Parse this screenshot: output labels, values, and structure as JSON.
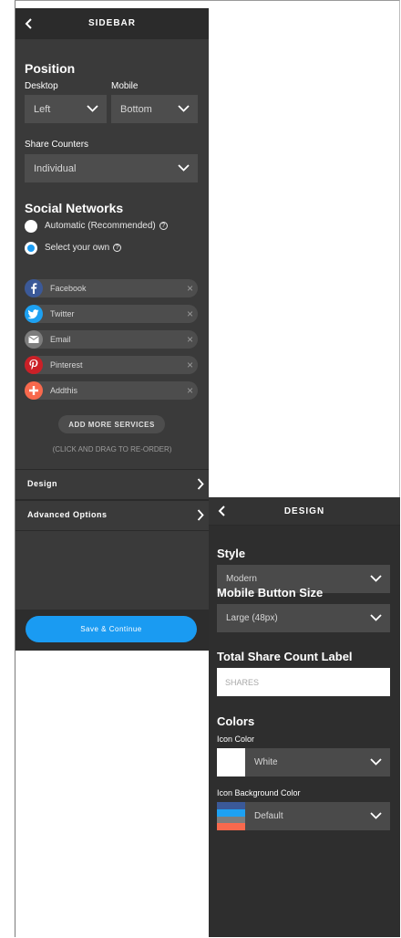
{
  "sidebar": {
    "header_title": "SIDEBAR",
    "position_title": "Position",
    "desktop_label": "Desktop",
    "mobile_label": "Mobile",
    "desktop_value": "Left",
    "mobile_value": "Bottom",
    "share_counters_label": "Share Counters",
    "share_counters_value": "Individual",
    "social_networks_title": "Social Networks",
    "radio_automatic": "Automatic (Recommended)",
    "radio_select_own": "Select your own",
    "selected_radio": "Select your own",
    "help_glyph": "?",
    "services": [
      {
        "name": "Facebook",
        "icon": "facebook-icon",
        "color": "#3b5998"
      },
      {
        "name": "Twitter",
        "icon": "twitter-icon",
        "color": "#1da1f2"
      },
      {
        "name": "Email",
        "icon": "email-icon",
        "color": "#7d7d7d"
      },
      {
        "name": "Pinterest",
        "icon": "pinterest-icon",
        "color": "#cb2027"
      },
      {
        "name": "Addthis",
        "icon": "addthis-icon",
        "color": "#f8694d"
      }
    ],
    "remove_glyph": "×",
    "add_more_label": "ADD MORE SERVICES",
    "drag_hint": "(CLICK AND DRAG TO RE-ORDER)",
    "nav_design": "Design",
    "nav_advanced": "Advanced Options",
    "save_label": "Save & Continue"
  },
  "design": {
    "header_title": "DESIGN",
    "style_title": "Style",
    "style_value": "Modern",
    "mobile_button_size_title": "Mobile Button Size",
    "mobile_button_size_value": "Large (48px)",
    "total_share_count_title": "Total Share Count Label",
    "total_share_count_placeholder": "SHARES",
    "colors_title": "Colors",
    "icon_color_label": "Icon Color",
    "icon_color_value": "White",
    "icon_bg_color_label": "Icon Background Color",
    "icon_bg_color_value": "Default"
  },
  "colors": {
    "accent": "#1a9bf2",
    "panel_bg": "#3a3a3a",
    "header_bg": "#2b2b2b"
  }
}
